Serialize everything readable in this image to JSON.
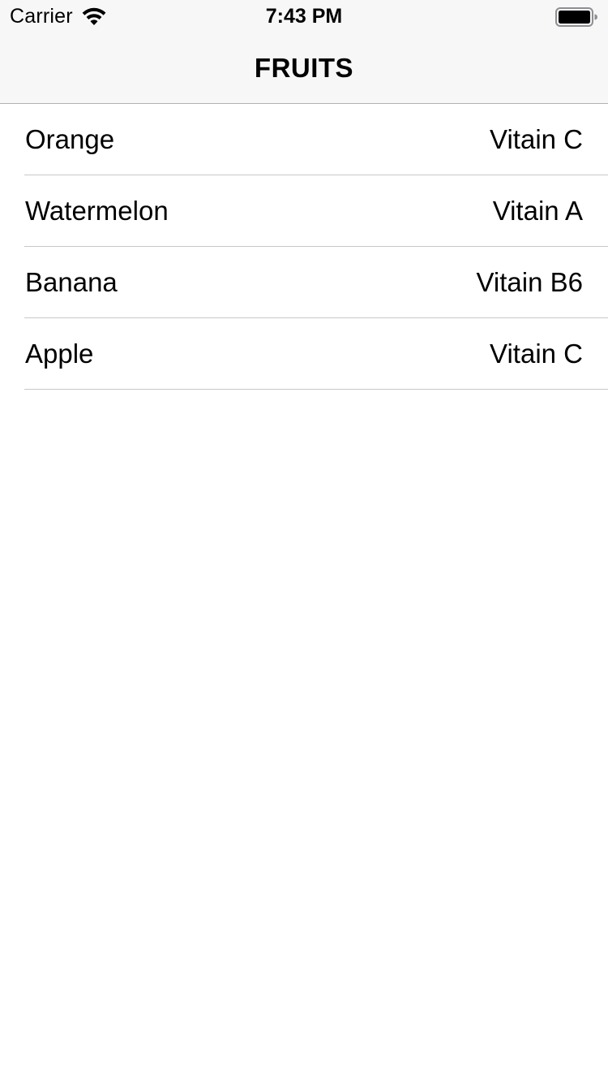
{
  "status_bar": {
    "carrier": "Carrier",
    "time": "7:43 PM",
    "wifi_icon": "wifi-icon",
    "battery_icon": "battery-icon"
  },
  "nav": {
    "title": "FRUITS"
  },
  "rows": [
    {
      "title": "Orange",
      "detail": "Vitain C"
    },
    {
      "title": "Watermelon",
      "detail": "Vitain A"
    },
    {
      "title": "Banana",
      "detail": "Vitain B6"
    },
    {
      "title": "Apple",
      "detail": "Vitain C"
    }
  ],
  "colors": {
    "nav_background": "#f7f7f7",
    "separator": "#c8c7cc",
    "text": "#000000"
  }
}
